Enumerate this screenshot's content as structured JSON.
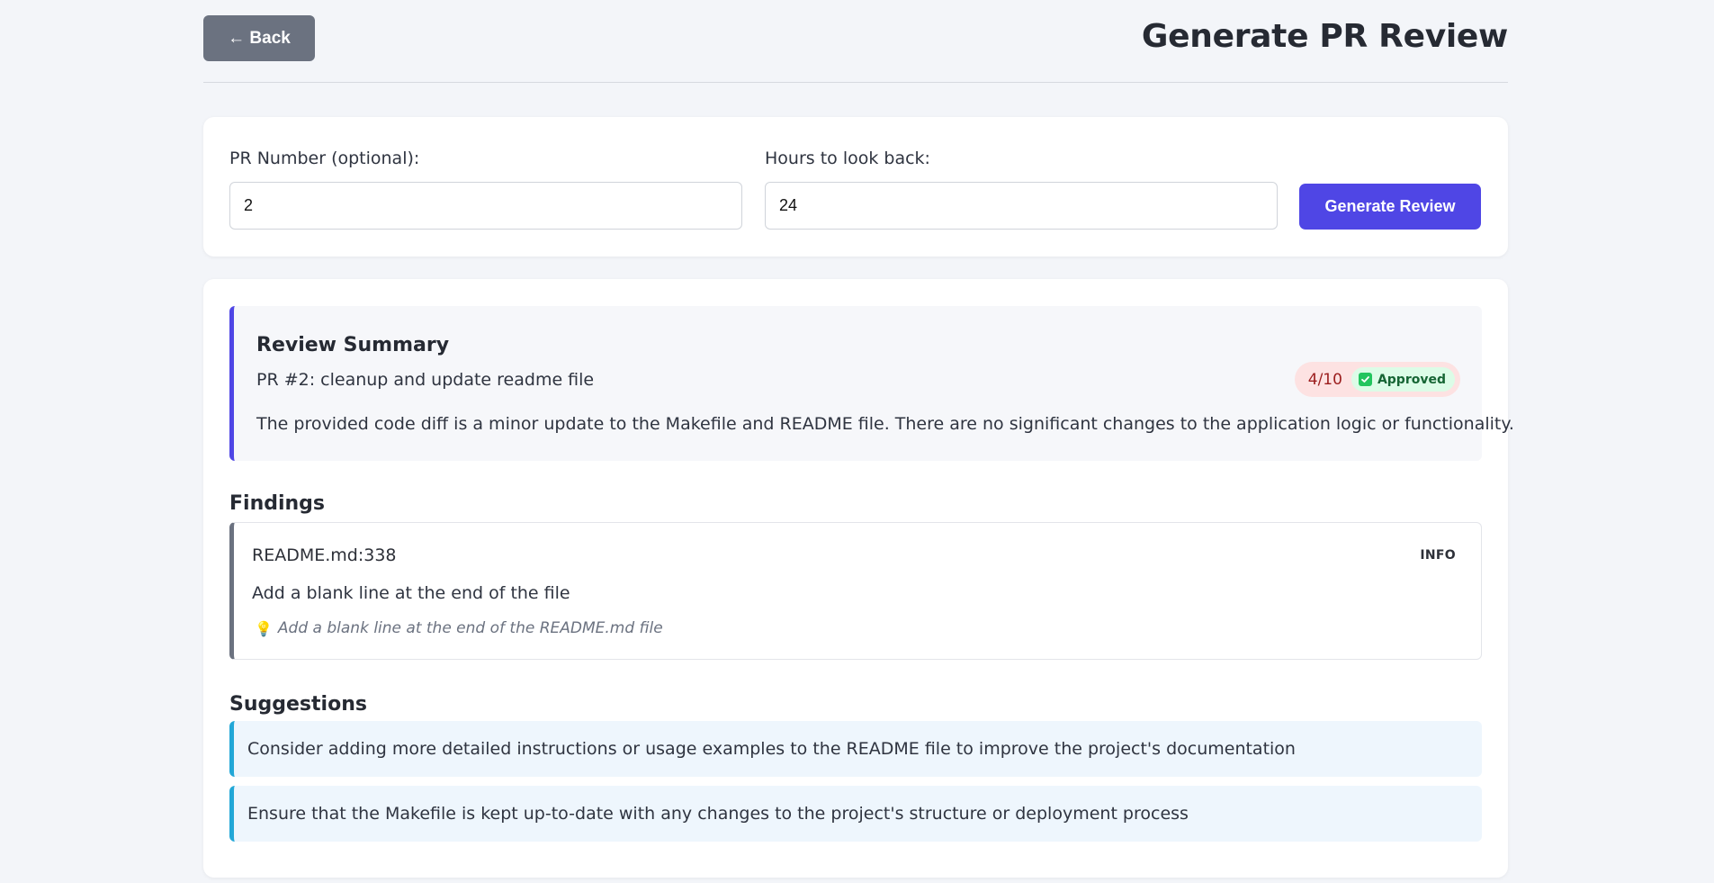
{
  "header": {
    "back_label": "← Back",
    "title": "Generate PR Review"
  },
  "form": {
    "pr_label": "PR Number (optional):",
    "pr_value": "2",
    "hours_label": "Hours to look back:",
    "hours_value": "24",
    "generate_label": "Generate Review"
  },
  "summary": {
    "heading": "Review Summary",
    "pr_title": "PR #2: cleanup and update readme file",
    "score": "4/10",
    "status": "Approved",
    "text": "The provided code diff is a minor update to the Makefile and README file. There are no significant changes to the application logic or functionality."
  },
  "findings": {
    "heading": "Findings",
    "items": [
      {
        "location": "README.md:338",
        "severity": "INFO",
        "message": "Add a blank line at the end of the file",
        "suggestion": "Add a blank line at the end of the README.md file",
        "icon": "lightbulb-icon"
      }
    ]
  },
  "suggestions": {
    "heading": "Suggestions",
    "items": [
      "Consider adding more detailed instructions or usage examples to the README file to improve the project's documentation",
      "Ensure that the Makefile is kept up-to-date with any changes to the project's structure or deployment process"
    ]
  },
  "colors": {
    "primary": "#4f46e5",
    "back_button": "#6b7280",
    "score_bg": "#fde2e2",
    "approved_bg": "#dcfce7",
    "suggestion_accent": "#22a7d7"
  }
}
